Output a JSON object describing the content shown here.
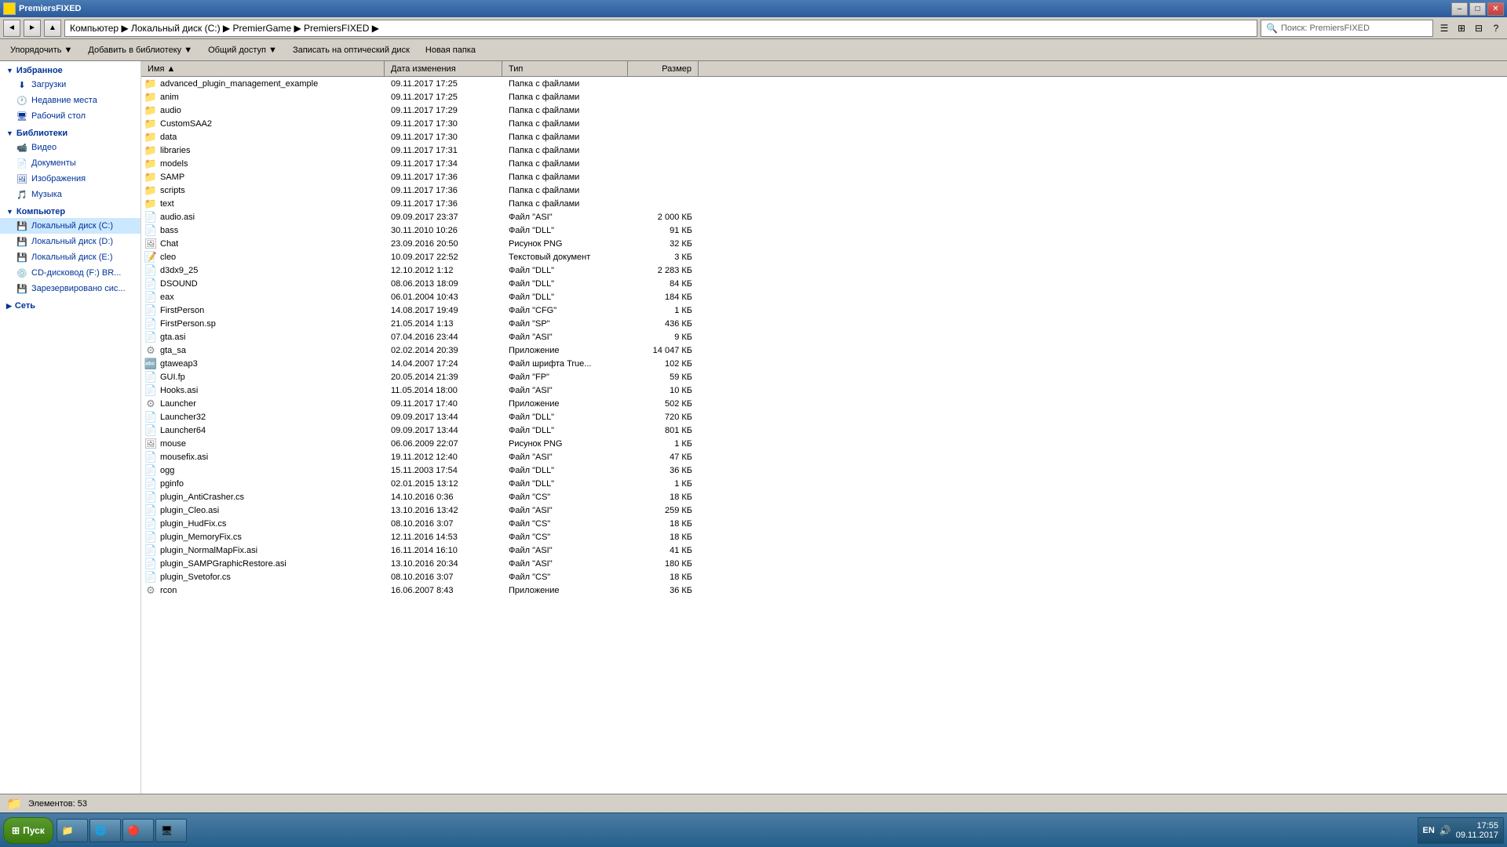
{
  "window": {
    "title": "PremiersFIXED",
    "icon": "folder"
  },
  "titlebar": {
    "title": "PremiersFIXED",
    "min_label": "–",
    "max_label": "□",
    "close_label": "✕"
  },
  "addressbar": {
    "back_label": "◄",
    "forward_label": "►",
    "up_label": "▲",
    "path": "Компьютер ▶ Локальный диск (C:) ▶ PremierGame ▶ PremiersFIXED ▶",
    "search_placeholder": "Поиск: PremiersFIXED",
    "search_value": "Поиск: PremiersFIXED"
  },
  "toolbar": {
    "organize_label": "Упорядочить ▼",
    "add_library_label": "Добавить в библиотеку ▼",
    "share_label": "Общий доступ ▼",
    "burn_label": "Записать на оптический диск",
    "new_folder_label": "Новая папка"
  },
  "columns": {
    "name": "Имя ▲",
    "date": "Дата изменения",
    "type": "Тип",
    "size": "Размер"
  },
  "sidebar": {
    "favorites_label": "Избранное",
    "favorites_items": [
      {
        "name": "Загрузки",
        "icon": "⬇"
      },
      {
        "name": "Недавние места",
        "icon": "🕐"
      },
      {
        "name": "Рабочий стол",
        "icon": "🖥"
      }
    ],
    "libraries_label": "Библиотеки",
    "libraries_items": [
      {
        "name": "Видео",
        "icon": "📹"
      },
      {
        "name": "Документы",
        "icon": "📄"
      },
      {
        "name": "Изображения",
        "icon": "🖼"
      },
      {
        "name": "Музыка",
        "icon": "🎵"
      }
    ],
    "computer_label": "Компьютер",
    "computer_items": [
      {
        "name": "Локальный диск (C:)",
        "icon": "💾"
      },
      {
        "name": "Локальный диск (D:)",
        "icon": "💾"
      },
      {
        "name": "Локальный диск (E:)",
        "icon": "💾"
      },
      {
        "name": "CD-дисковод (F:) BR...",
        "icon": "💿"
      },
      {
        "name": "Зарезервировано сис...",
        "icon": "💾"
      }
    ],
    "network_label": "Сеть"
  },
  "files": [
    {
      "name": "advanced_plugin_management_example",
      "date": "09.11.2017 17:25",
      "type": "Папка с файлами",
      "size": "",
      "icon": "folder",
      "is_folder": true
    },
    {
      "name": "anim",
      "date": "09.11.2017 17:25",
      "type": "Папка с файлами",
      "size": "",
      "icon": "folder",
      "is_folder": true
    },
    {
      "name": "audio",
      "date": "09.11.2017 17:29",
      "type": "Папка с файлами",
      "size": "",
      "icon": "folder",
      "is_folder": true
    },
    {
      "name": "CustomSAA2",
      "date": "09.11.2017 17:30",
      "type": "Папка с файлами",
      "size": "",
      "icon": "folder",
      "is_folder": true
    },
    {
      "name": "data",
      "date": "09.11.2017 17:30",
      "type": "Папка с файлами",
      "size": "",
      "icon": "folder",
      "is_folder": true
    },
    {
      "name": "libraries",
      "date": "09.11.2017 17:31",
      "type": "Папка с файлами",
      "size": "",
      "icon": "folder",
      "is_folder": true
    },
    {
      "name": "models",
      "date": "09.11.2017 17:34",
      "type": "Папка с файлами",
      "size": "",
      "icon": "folder",
      "is_folder": true
    },
    {
      "name": "SAMP",
      "date": "09.11.2017 17:36",
      "type": "Папка с файлами",
      "size": "",
      "icon": "folder",
      "is_folder": true
    },
    {
      "name": "scripts",
      "date": "09.11.2017 17:36",
      "type": "Папка с файлами",
      "size": "",
      "icon": "folder",
      "is_folder": true
    },
    {
      "name": "text",
      "date": "09.11.2017 17:36",
      "type": "Папка с файлами",
      "size": "",
      "icon": "folder",
      "is_folder": true
    },
    {
      "name": "audio.asi",
      "date": "09.09.2017 23:37",
      "type": "Файл \"ASI\"",
      "size": "2 000 КБ",
      "icon": "file",
      "is_folder": false
    },
    {
      "name": "bass",
      "date": "30.11.2010 10:26",
      "type": "Файл \"DLL\"",
      "size": "91 КБ",
      "icon": "file",
      "is_folder": false
    },
    {
      "name": "Chat",
      "date": "23.09.2016 20:50",
      "type": "Рисунок PNG",
      "size": "32 КБ",
      "icon": "png",
      "is_folder": false
    },
    {
      "name": "cleo",
      "date": "10.09.2017 22:52",
      "type": "Текстовый документ",
      "size": "3 КБ",
      "icon": "txt",
      "is_folder": false
    },
    {
      "name": "d3dx9_25",
      "date": "12.10.2012 1:12",
      "type": "Файл \"DLL\"",
      "size": "2 283 КБ",
      "icon": "file",
      "is_folder": false
    },
    {
      "name": "DSOUND",
      "date": "08.06.2013 18:09",
      "type": "Файл \"DLL\"",
      "size": "84 КБ",
      "icon": "file",
      "is_folder": false
    },
    {
      "name": "eax",
      "date": "06.01.2004 10:43",
      "type": "Файл \"DLL\"",
      "size": "184 КБ",
      "icon": "file",
      "is_folder": false
    },
    {
      "name": "FirstPerson",
      "date": "14.08.2017 19:49",
      "type": "Файл \"CFG\"",
      "size": "1 КБ",
      "icon": "file",
      "is_folder": false
    },
    {
      "name": "FirstPerson.sp",
      "date": "21.05.2014 1:13",
      "type": "Файл \"SP\"",
      "size": "436 КБ",
      "icon": "file",
      "is_folder": false
    },
    {
      "name": "gta.asi",
      "date": "07.04.2016 23:44",
      "type": "Файл \"ASI\"",
      "size": "9 КБ",
      "icon": "file",
      "is_folder": false
    },
    {
      "name": "gta_sa",
      "date": "02.02.2014 20:39",
      "type": "Приложение",
      "size": "14 047 КБ",
      "icon": "exe",
      "is_folder": false
    },
    {
      "name": "gtaweap3",
      "date": "14.04.2007 17:24",
      "type": "Файл шрифта True...",
      "size": "102 КБ",
      "icon": "font",
      "is_folder": false
    },
    {
      "name": "GUI.fp",
      "date": "20.05.2014 21:39",
      "type": "Файл \"FP\"",
      "size": "59 КБ",
      "icon": "file",
      "is_folder": false
    },
    {
      "name": "Hooks.asi",
      "date": "11.05.2014 18:00",
      "type": "Файл \"ASI\"",
      "size": "10 КБ",
      "icon": "file",
      "is_folder": false
    },
    {
      "name": "Launcher",
      "date": "09.11.2017 17:40",
      "type": "Приложение",
      "size": "502 КБ",
      "icon": "exe",
      "is_folder": false
    },
    {
      "name": "Launcher32",
      "date": "09.09.2017 13:44",
      "type": "Файл \"DLL\"",
      "size": "720 КБ",
      "icon": "file",
      "is_folder": false
    },
    {
      "name": "Launcher64",
      "date": "09.09.2017 13:44",
      "type": "Файл \"DLL\"",
      "size": "801 КБ",
      "icon": "file",
      "is_folder": false
    },
    {
      "name": "mouse",
      "date": "06.06.2009 22:07",
      "type": "Рисунок PNG",
      "size": "1 КБ",
      "icon": "png",
      "is_folder": false
    },
    {
      "name": "mousefix.asi",
      "date": "19.11.2012 12:40",
      "type": "Файл \"ASI\"",
      "size": "47 КБ",
      "icon": "file",
      "is_folder": false
    },
    {
      "name": "ogg",
      "date": "15.11.2003 17:54",
      "type": "Файл \"DLL\"",
      "size": "36 КБ",
      "icon": "file",
      "is_folder": false
    },
    {
      "name": "pginfo",
      "date": "02.01.2015 13:12",
      "type": "Файл \"DLL\"",
      "size": "1 КБ",
      "icon": "file",
      "is_folder": false
    },
    {
      "name": "plugin_AntiCrasher.cs",
      "date": "14.10.2016 0:36",
      "type": "Файл \"CS\"",
      "size": "18 КБ",
      "icon": "file",
      "is_folder": false
    },
    {
      "name": "plugin_Cleo.asi",
      "date": "13.10.2016 13:42",
      "type": "Файл \"ASI\"",
      "size": "259 КБ",
      "icon": "file",
      "is_folder": false
    },
    {
      "name": "plugin_HudFix.cs",
      "date": "08.10.2016 3:07",
      "type": "Файл \"CS\"",
      "size": "18 КБ",
      "icon": "file",
      "is_folder": false
    },
    {
      "name": "plugin_MemoryFix.cs",
      "date": "12.11.2016 14:53",
      "type": "Файл \"CS\"",
      "size": "18 КБ",
      "icon": "file",
      "is_folder": false
    },
    {
      "name": "plugin_NormalMapFix.asi",
      "date": "16.11.2014 16:10",
      "type": "Файл \"ASI\"",
      "size": "41 КБ",
      "icon": "file",
      "is_folder": false
    },
    {
      "name": "plugin_SAMPGraphicRestore.asi",
      "date": "13.10.2016 20:34",
      "type": "Файл \"ASI\"",
      "size": "180 КБ",
      "icon": "file",
      "is_folder": false
    },
    {
      "name": "plugin_Svetofor.cs",
      "date": "08.10.2016 3:07",
      "type": "Файл \"CS\"",
      "size": "18 КБ",
      "icon": "file",
      "is_folder": false
    },
    {
      "name": "rcon",
      "date": "16.06.2007 8:43",
      "type": "Приложение",
      "size": "36 КБ",
      "icon": "exe",
      "is_folder": false
    }
  ],
  "status": {
    "text": "Элементов: 53"
  },
  "taskbar": {
    "start_label": "Пуск",
    "clock": "17:55",
    "date": "09.11.2017",
    "lang": "EN",
    "items": [
      {
        "label": "📁"
      },
      {
        "label": "🌐"
      },
      {
        "label": "🔴"
      },
      {
        "label": "🖥"
      }
    ]
  }
}
